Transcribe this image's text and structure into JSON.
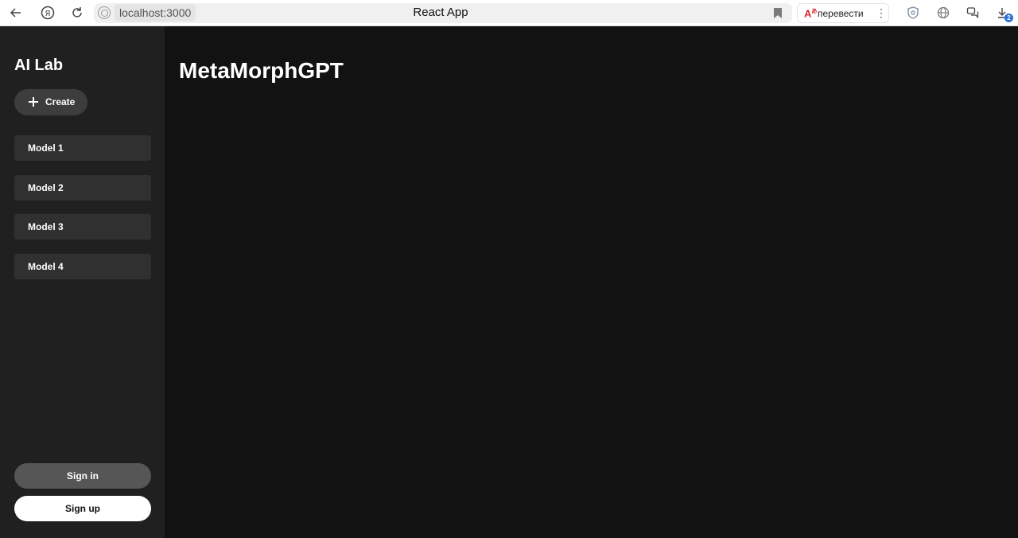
{
  "browser": {
    "url": "localhost:3000",
    "tab_title": "React App",
    "translate_label": "перевести",
    "translate_icon_text": "A",
    "download_count": "2"
  },
  "sidebar": {
    "brand": "AI Lab",
    "create_label": "Create",
    "models": [
      {
        "label": "Model 1"
      },
      {
        "label": "Model 2"
      },
      {
        "label": "Model 3"
      },
      {
        "label": "Model 4"
      }
    ],
    "sign_in_label": "Sign in",
    "sign_up_label": "Sign up"
  },
  "main": {
    "title": "MetaMorphGPT"
  },
  "colors": {
    "sidebar_bg": "#202020",
    "main_bg": "#121212",
    "model_item_bg": "#303030",
    "create_bg": "#3d3d3d",
    "sign_in_bg": "#565656",
    "sign_up_bg": "#ffffff"
  }
}
